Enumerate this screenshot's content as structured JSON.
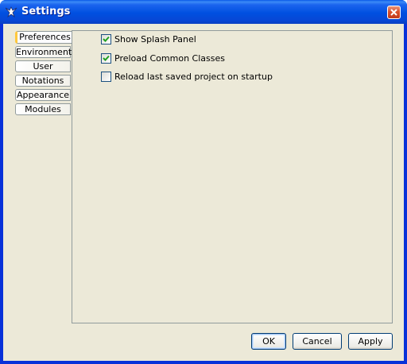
{
  "window": {
    "title": "Settings"
  },
  "tabs": [
    {
      "label": "Preferences",
      "selected": true
    },
    {
      "label": "Environment",
      "selected": false
    },
    {
      "label": "User",
      "selected": false
    },
    {
      "label": "Notations",
      "selected": false
    },
    {
      "label": "Appearance",
      "selected": false
    },
    {
      "label": "Modules",
      "selected": false
    }
  ],
  "preferences": {
    "options": [
      {
        "label": "Show Splash Panel",
        "checked": true
      },
      {
        "label": "Preload Common Classes",
        "checked": true
      },
      {
        "label": "Reload last saved project on startup",
        "checked": false
      }
    ]
  },
  "buttons": {
    "ok": "OK",
    "cancel": "Cancel",
    "apply": "Apply"
  },
  "icons": {
    "app": "argouml-app-icon",
    "close": "close-icon",
    "check": "checkmark-icon"
  },
  "colors": {
    "titlebar": "#0050E0",
    "client": "#ECE9D8",
    "tab_highlight": "#FFC83C",
    "check": "#21A121"
  }
}
